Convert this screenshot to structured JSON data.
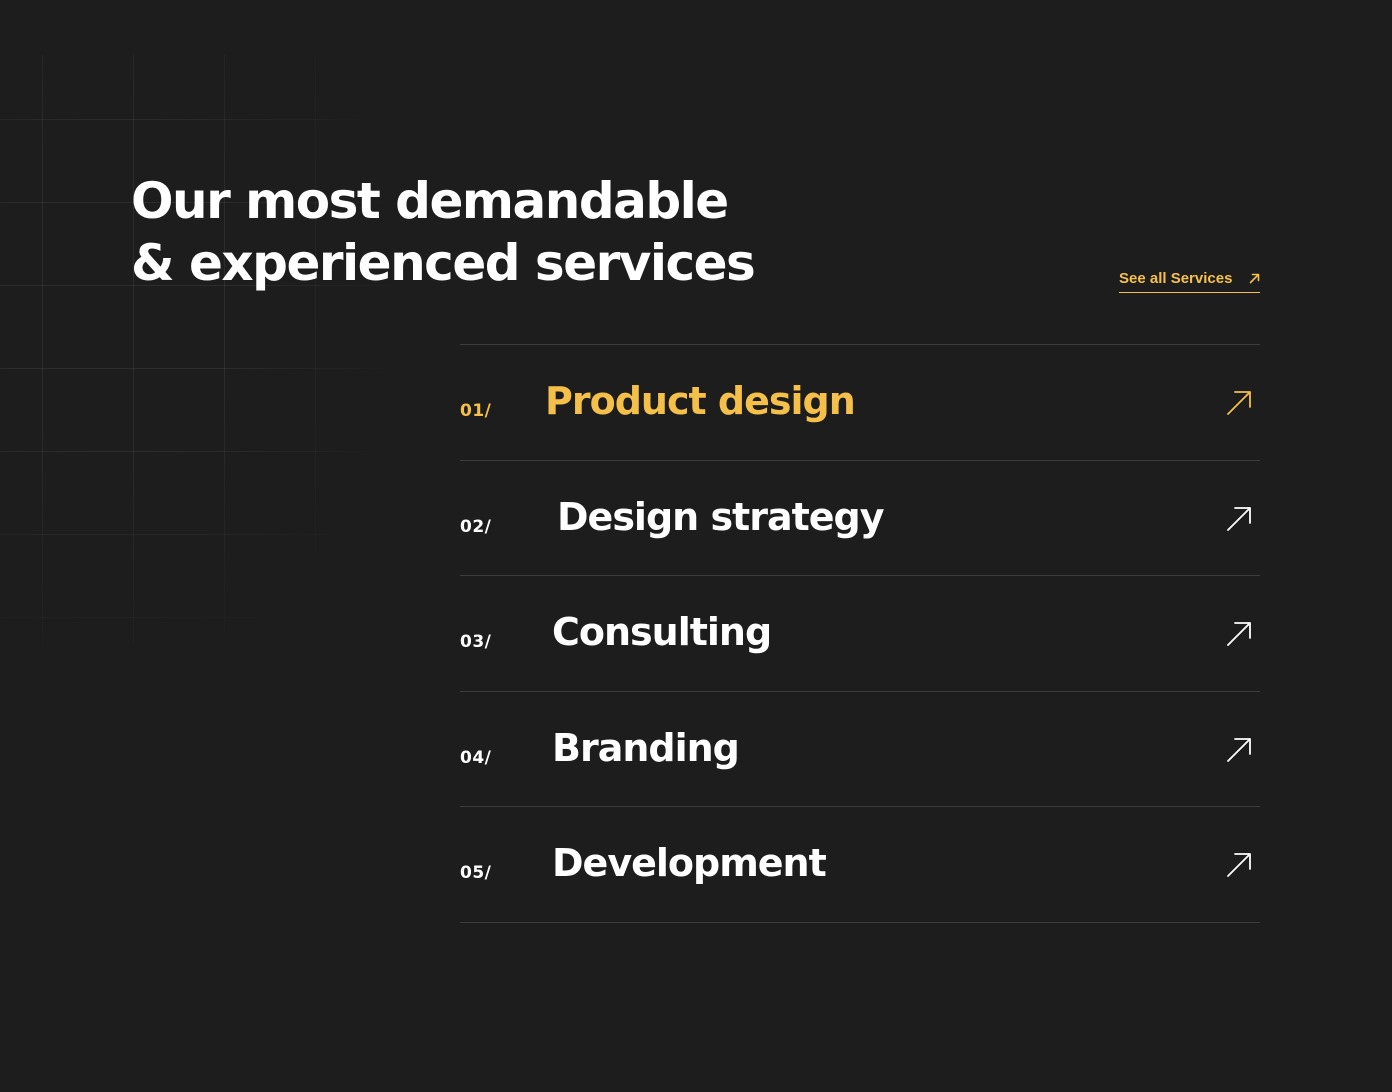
{
  "heading": {
    "line1": "Our most  demandable",
    "line2": "& experienced services"
  },
  "see_all": {
    "label": "See all Services",
    "icon": "arrow-up-right-icon"
  },
  "colors": {
    "background": "#1d1d1d",
    "accent": "#f5c04a",
    "text": "#ffffff",
    "divider": "#3c3c3c"
  },
  "services": [
    {
      "number": "01/",
      "title": "Product design",
      "icon": "arrow-up-right-icon",
      "active": true
    },
    {
      "number": "02/",
      "title": "Design strategy",
      "icon": "arrow-up-right-icon",
      "active": false
    },
    {
      "number": "03/",
      "title": "Consulting",
      "icon": "arrow-up-right-icon",
      "active": false
    },
    {
      "number": "04/",
      "title": "Branding",
      "icon": "arrow-up-right-icon",
      "active": false
    },
    {
      "number": "05/",
      "title": "Development",
      "icon": "arrow-up-right-icon",
      "active": false
    }
  ]
}
